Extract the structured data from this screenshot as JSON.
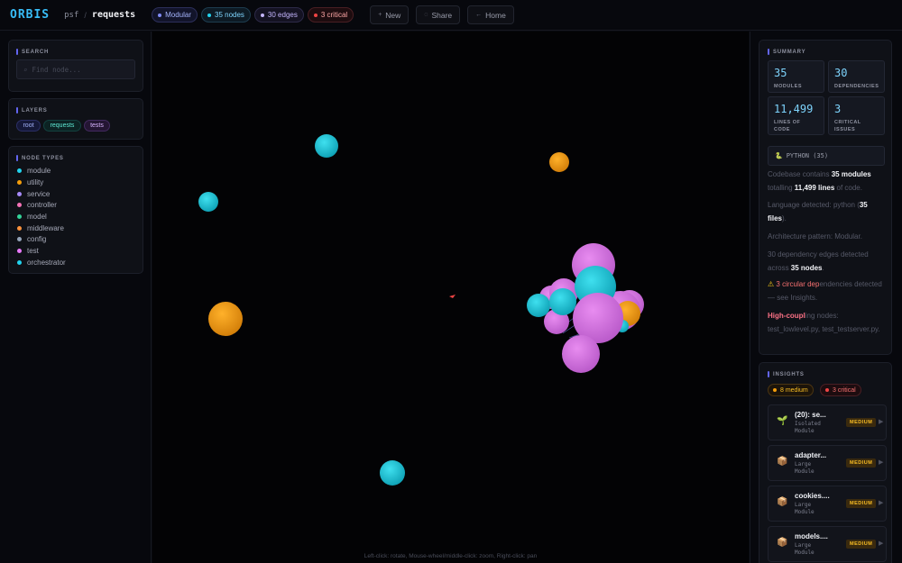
{
  "topbar": {
    "logo": "ORBIS",
    "org": "psf",
    "separator": "/",
    "repo": "requests",
    "badges": {
      "pattern": "Modular",
      "nodes": "35 nodes",
      "edges": "30 edges",
      "critical": "3 critical"
    },
    "buttons": {
      "new": "New",
      "share": "Share",
      "home": "Home"
    }
  },
  "search": {
    "title": "SEARCH",
    "placeholder": "Find node..."
  },
  "layers": {
    "title": "LAYERS",
    "items": [
      "root",
      "requests",
      "tests"
    ]
  },
  "node_types": {
    "title": "NODE TYPES",
    "items": [
      {
        "label": "module",
        "color": "#22d3ee"
      },
      {
        "label": "utility",
        "color": "#f59e0b"
      },
      {
        "label": "service",
        "color": "#a78bfa"
      },
      {
        "label": "controller",
        "color": "#f472b6"
      },
      {
        "label": "model",
        "color": "#34d399"
      },
      {
        "label": "middleware",
        "color": "#fb923c"
      },
      {
        "label": "config",
        "color": "#94a3b8"
      },
      {
        "label": "test",
        "color": "#e879f9"
      },
      {
        "label": "orchestrator",
        "color": "#22d3ee"
      }
    ]
  },
  "canvas": {
    "hint": "Left-click: rotate, Mouse-wheel/middle-click: zoom, Right-click: pan",
    "colors": {
      "module": "#1ec3d6",
      "utility": "#f29a0e",
      "test": "#d774e2"
    }
  },
  "summary": {
    "title": "SUMMARY",
    "stats": [
      {
        "value": "35",
        "label": "MODULES"
      },
      {
        "value": "30",
        "label": "DEPENDENCIES"
      },
      {
        "value": "11,499",
        "label": "LINES OF CODE"
      },
      {
        "value": "3",
        "label": "CRITICAL ISSUES"
      }
    ],
    "language": "PYTHON (35)",
    "text": {
      "p1_a": "Codebase contains ",
      "p1_b": "35 modules",
      "p1_c": " totalling ",
      "p1_d": "11,499 lines",
      "p1_e": " of code.",
      "p2_a": "Language detected: python (",
      "p2_b": "35 files",
      "p2_c": ").",
      "p3": "Architecture pattern: Modular.",
      "p4_a": "30 dependency edges detected across ",
      "p4_b": "35 nodes",
      "p4_c": ".",
      "p5_a": "3 ",
      "p5_b": "circular dep",
      "p5_c": "endencies detected — see Insights.",
      "p6_a": "High-coupl",
      "p6_b": "ing nodes: test_lowlevel.py, test_testserver.py."
    }
  },
  "insights": {
    "title": "INSIGHTS",
    "medium": "8 medium",
    "critical": "3 critical",
    "items": [
      {
        "title": "(20): se...",
        "sub1": "Isolated",
        "sub2": "Module",
        "badge": "MEDIUM",
        "icon": "seedling-icon"
      },
      {
        "title": "adapter...",
        "sub1": "Large",
        "sub2": "Module",
        "badge": "MEDIUM",
        "icon": "package-icon"
      },
      {
        "title": "cookies....",
        "sub1": "Large",
        "sub2": "Module",
        "badge": "MEDIUM",
        "icon": "package-icon"
      },
      {
        "title": "models....",
        "sub1": "Large",
        "sub2": "Module",
        "badge": "MEDIUM",
        "icon": "package-icon"
      }
    ]
  }
}
